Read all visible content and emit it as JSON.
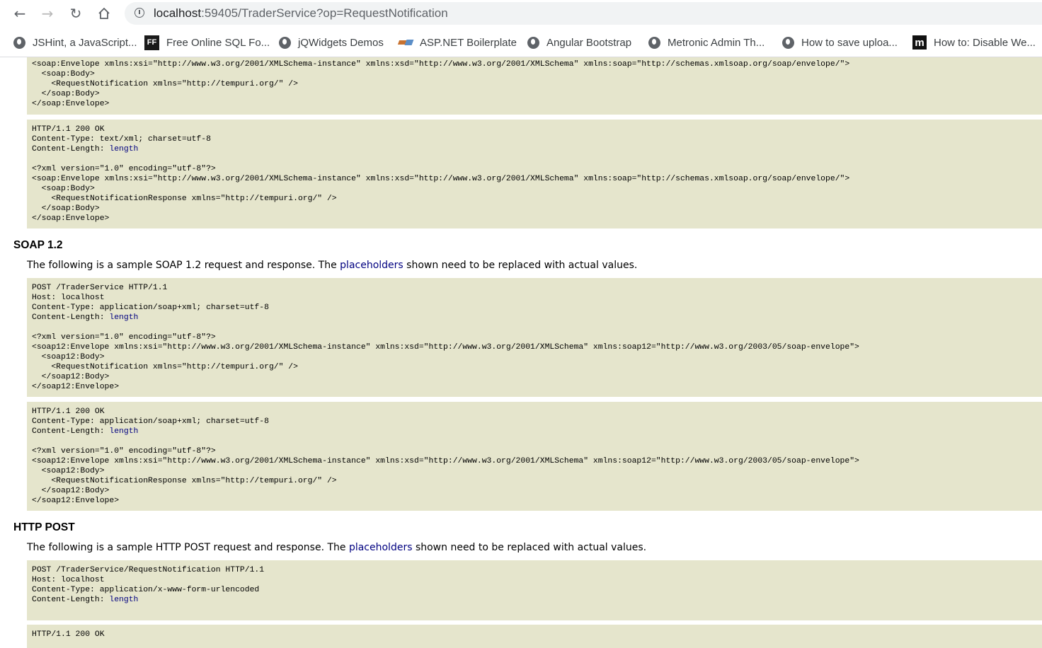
{
  "browser": {
    "url_host": "localhost",
    "url_rest": ":59405/TraderService?op=RequestNotification",
    "bookmarks": [
      {
        "label": "JSHint, a JavaScript...",
        "icon": "globe-icon"
      },
      {
        "label": "Free Online SQL Fo...",
        "icon": "ff-icon"
      },
      {
        "label": "jQWidgets Demos",
        "icon": "globe-icon"
      },
      {
        "label": "ASP.NET Boilerplate",
        "icon": "aspnet-boilerplate-icon"
      },
      {
        "label": "Angular Bootstrap",
        "icon": "globe-icon"
      },
      {
        "label": "Metronic Admin Th...",
        "icon": "globe-icon"
      },
      {
        "label": "How to save uploa...",
        "icon": "globe-icon"
      },
      {
        "label": "How to: Disable We...",
        "icon": "m-icon"
      }
    ]
  },
  "soap11": {
    "request_lines": [
      "<soap:Envelope xmlns:xsi=\"http://www.w3.org/2001/XMLSchema-instance\" xmlns:xsd=\"http://www.w3.org/2001/XMLSchema\" xmlns:soap=\"http://schemas.xmlsoap.org/soap/envelope/\">",
      "  <soap:Body>",
      "    <RequestNotification xmlns=\"http://tempuri.org/\" />",
      "  </soap:Body>",
      "</soap:Envelope>"
    ],
    "response_head": "HTTP/1.1 200 OK\nContent-Type: text/xml; charset=utf-8\nContent-Length: ",
    "placeholder": "length",
    "response_body": "\n\n<?xml version=\"1.0\" encoding=\"utf-8\"?>\n<soap:Envelope xmlns:xsi=\"http://www.w3.org/2001/XMLSchema-instance\" xmlns:xsd=\"http://www.w3.org/2001/XMLSchema\" xmlns:soap=\"http://schemas.xmlsoap.org/soap/envelope/\">\n  <soap:Body>\n    <RequestNotificationResponse xmlns=\"http://tempuri.org/\" />\n  </soap:Body>\n</soap:Envelope>"
  },
  "soap12": {
    "heading": "SOAP 1.2",
    "desc_before": "The following is a sample SOAP 1.2 request and response. The ",
    "desc_link": "placeholders",
    "desc_after": " shown need to be replaced with actual values.",
    "request_head": "POST /TraderService HTTP/1.1\nHost: localhost\nContent-Type: application/soap+xml; charset=utf-8\nContent-Length: ",
    "request_placeholder": "length",
    "request_body": "\n\n<?xml version=\"1.0\" encoding=\"utf-8\"?>\n<soap12:Envelope xmlns:xsi=\"http://www.w3.org/2001/XMLSchema-instance\" xmlns:xsd=\"http://www.w3.org/2001/XMLSchema\" xmlns:soap12=\"http://www.w3.org/2003/05/soap-envelope\">\n  <soap12:Body>\n    <RequestNotification xmlns=\"http://tempuri.org/\" />\n  </soap12:Body>\n</soap12:Envelope>",
    "response_head": "HTTP/1.1 200 OK\nContent-Type: application/soap+xml; charset=utf-8\nContent-Length: ",
    "response_placeholder": "length",
    "response_body": "\n\n<?xml version=\"1.0\" encoding=\"utf-8\"?>\n<soap12:Envelope xmlns:xsi=\"http://www.w3.org/2001/XMLSchema-instance\" xmlns:xsd=\"http://www.w3.org/2001/XMLSchema\" xmlns:soap12=\"http://www.w3.org/2003/05/soap-envelope\">\n  <soap12:Body>\n    <RequestNotificationResponse xmlns=\"http://tempuri.org/\" />\n  </soap12:Body>\n</soap12:Envelope>"
  },
  "httppost": {
    "heading": "HTTP POST",
    "desc_before": "The following is a sample HTTP POST request and response. The ",
    "desc_link": "placeholders",
    "desc_after": " shown need to be replaced with actual values.",
    "request_head": "POST /TraderService/RequestNotification HTTP/1.1\nHost: localhost\nContent-Type: application/x-www-form-urlencoded\nContent-Length: ",
    "request_placeholder": "length",
    "response_head": "HTTP/1.1 200 OK"
  }
}
